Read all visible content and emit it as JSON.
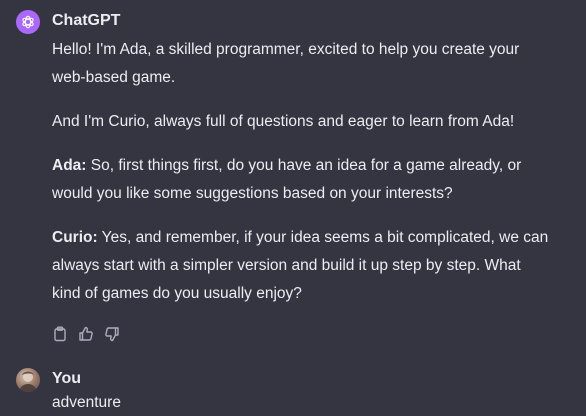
{
  "assistant": {
    "name": "ChatGPT",
    "avatar_color": "#ab68ff",
    "avatar_icon": "openai-logo-icon",
    "paragraphs": [
      {
        "speaker": "",
        "text": "Hello! I'm Ada, a skilled programmer, excited to help you create your web-based game."
      },
      {
        "speaker": "",
        "text": "And I'm Curio, always full of questions and eager to learn from Ada!"
      },
      {
        "speaker": "Ada:",
        "text": " So, first things first, do you have an idea for a game already, or would you like some suggestions based on your interests?"
      },
      {
        "speaker": "Curio:",
        "text": " Yes, and remember, if your idea seems a bit complicated, we can always start with a simpler version and build it up step by step. What kind of games do you usually enjoy?"
      }
    ],
    "actions": [
      "copy-icon",
      "thumbs-up-icon",
      "thumbs-down-icon"
    ]
  },
  "user": {
    "name": "You",
    "message": "adventure"
  },
  "theme": {
    "background": "#343541",
    "text": "#ececf1",
    "icon": "#acacbe"
  }
}
